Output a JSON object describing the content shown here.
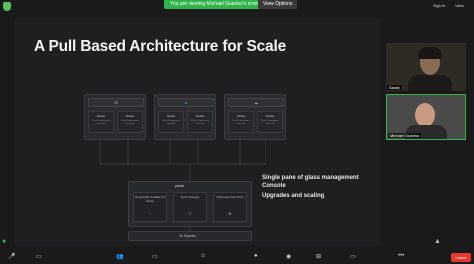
{
  "topbar": {
    "banner": "You are viewing Michael Guarino's screen",
    "view_options": "View Options",
    "sign_in": "Sign in",
    "view": "View"
  },
  "slide": {
    "title": "A Pull Based Architecture for Scale",
    "clusters": [
      {
        "head": "⊞",
        "services": [
          {
            "title": "Cluster",
            "sub": "Plural Deployment Operator"
          },
          {
            "title": "Cluster",
            "sub": "Plural Deployment Operator"
          }
        ]
      },
      {
        "head": "▲",
        "services": [
          {
            "title": "Cluster",
            "sub": "Plural Deployment Operator"
          },
          {
            "title": "Cluster",
            "sub": "Plural Deployment Operator"
          }
        ]
      },
      {
        "head": "☁",
        "services": [
          {
            "title": "Cluster",
            "sub": "Plural Deployment Operator"
          },
          {
            "title": "Cluster",
            "sub": "Plural Deployment Operator"
          }
        ]
      }
    ],
    "hub_label": "plural",
    "hub_cards": [
      {
        "title": "Dynamically Scalable Git Cache",
        "icon": "◔"
      },
      {
        "title": "Secret Manager",
        "icon": "▽"
      },
      {
        "title": "Kubernetes Auth Proxy",
        "icon": "⎈"
      }
    ],
    "bottom_label": "Git Modules",
    "desc1": "Single pane of glass management Console",
    "desc2": "Upgrades and scaling"
  },
  "participants": [
    {
      "name": "Sarah"
    },
    {
      "name": "Michael Guarino"
    }
  ],
  "toolbar": {
    "leave": "Leave"
  },
  "colors": {
    "banner_green": "#2fb34a",
    "leave_red": "#e5392f"
  }
}
